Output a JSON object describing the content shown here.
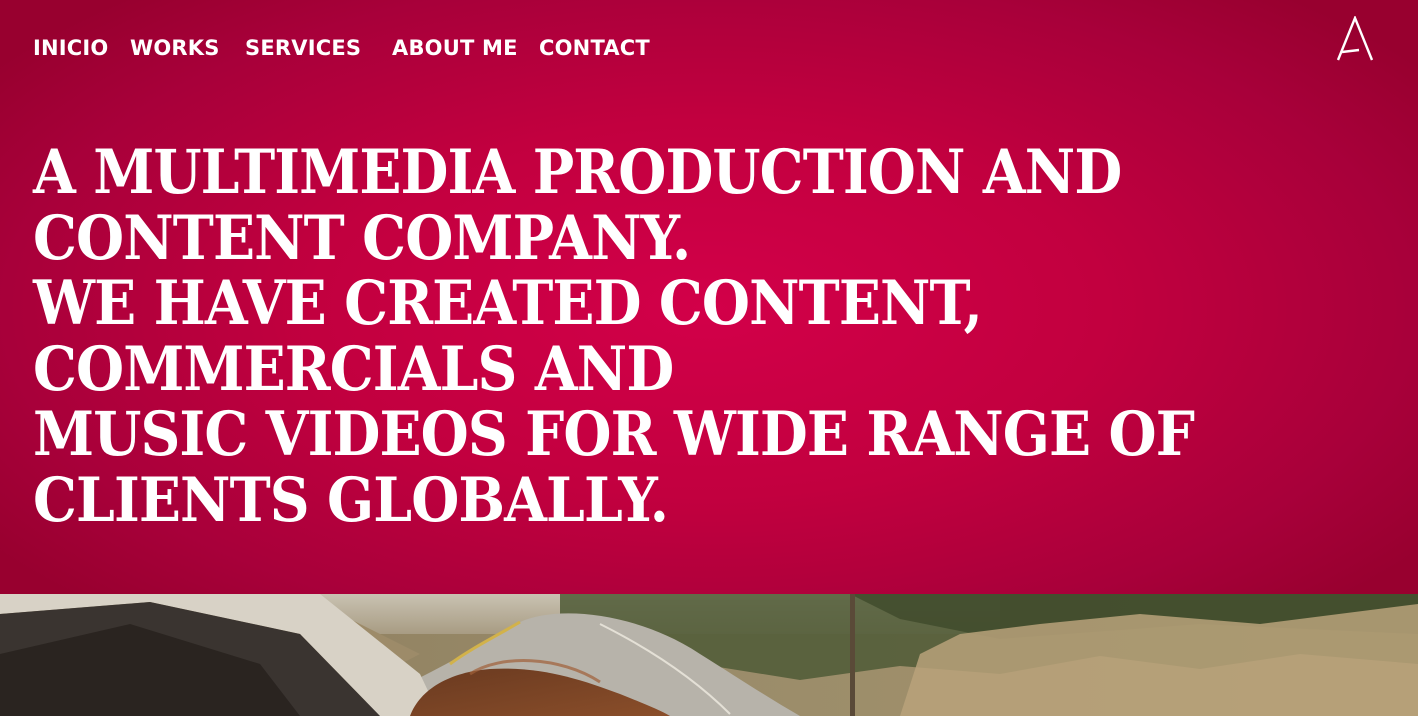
{
  "nav": {
    "items": [
      {
        "label": "INICIO"
      },
      {
        "label": "WORKS"
      },
      {
        "label": "SERVICES"
      },
      {
        "label": "ABOUT ME"
      },
      {
        "label": "CONTACT"
      }
    ]
  },
  "logo": {
    "icon": "letter-a-logo-icon"
  },
  "hero": {
    "headline_lines": [
      "A MULTIMEDIA PRODUCTION AND",
      "CONTENT COMPANY.",
      "WE HAVE CREATED CONTENT,",
      "COMMERCIALS AND",
      "MUSIC VIDEOS FOR WIDE RANGE OF",
      "CLIENTS GLOBALLY."
    ]
  },
  "colors": {
    "background": "#b0003a",
    "accent": "#d20049",
    "text": "#ffffff"
  }
}
